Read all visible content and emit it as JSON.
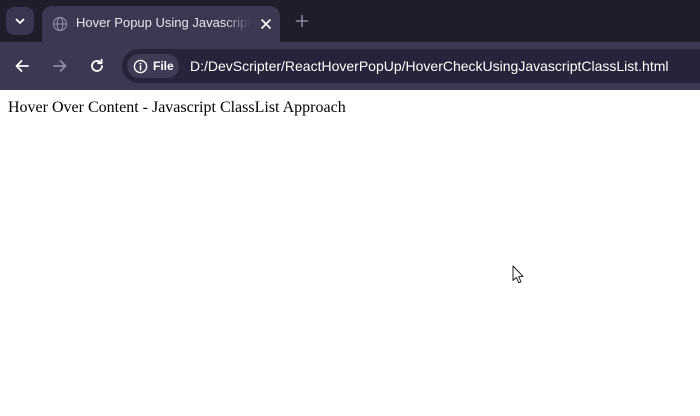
{
  "browser": {
    "tab": {
      "title": "Hover Popup Using Javascript ClassList"
    },
    "address_bar": {
      "site_chip_label": "File",
      "url": "D:/DevScripter/ReactHoverPopUp/HoverCheckUsingJavascriptClassList.html"
    },
    "icons": {
      "tab_search": "chevron-down-icon",
      "favicon": "globe-icon",
      "tab_close": "close-icon",
      "new_tab": "plus-icon",
      "back": "arrow-left-icon",
      "forward": "arrow-right-icon",
      "reload": "reload-icon",
      "site_info": "info-icon",
      "cursor": "mouse-pointer-icon"
    },
    "colors": {
      "tabstrip_bg": "#1f1c2b",
      "toolbar_bg": "#3c3852",
      "omnibox_bg": "#27233a",
      "page_bg": "#ffffff"
    }
  },
  "page": {
    "heading": "Hover Over Content - Javascript ClassList Approach"
  }
}
